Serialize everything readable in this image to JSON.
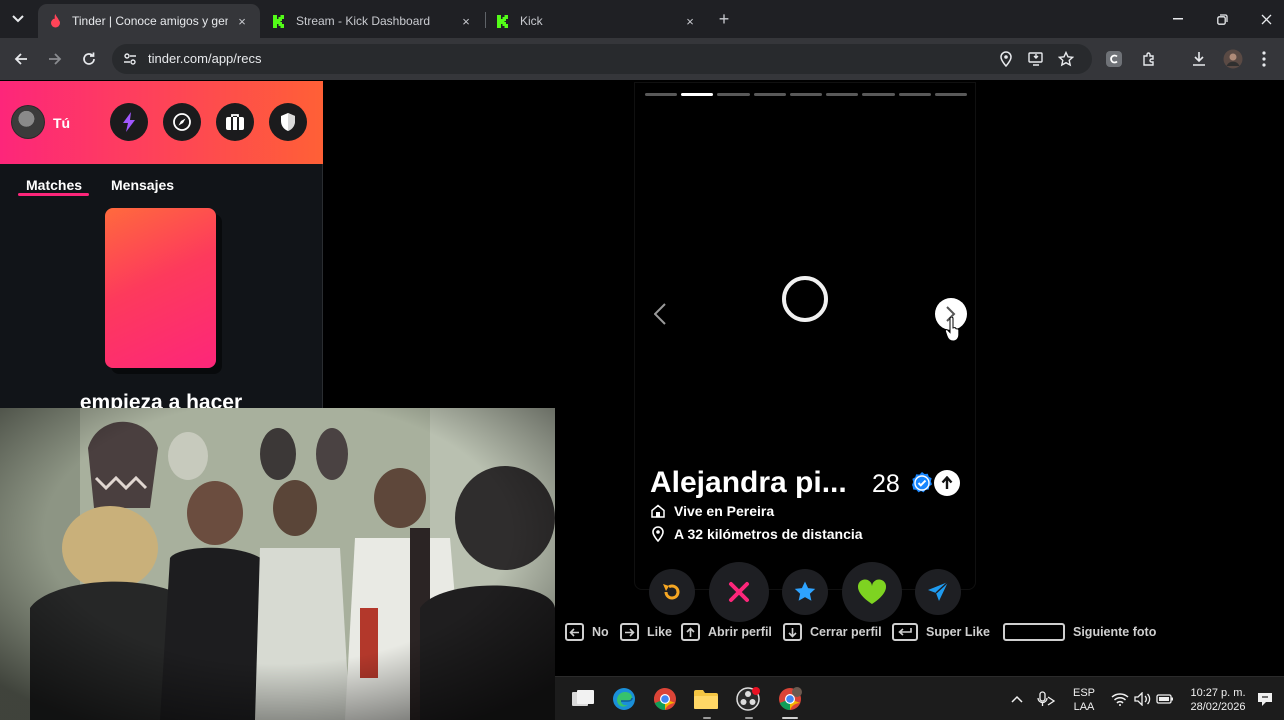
{
  "browser": {
    "tabs": [
      {
        "title": "Tinder | Conoce amigos y gente",
        "active": true
      },
      {
        "title": "Stream - Kick Dashboard",
        "active": false
      },
      {
        "title": "Kick",
        "active": false
      }
    ],
    "close_glyph": "×",
    "new_tab_glyph": "+",
    "url": "tinder.com/app/recs"
  },
  "sidebar": {
    "you_label": "Tú",
    "tabs": [
      "Matches",
      "Mensajes"
    ],
    "empty_text": "empieza a hacer",
    "header_buttons": [
      "bolt-icon",
      "compass-icon",
      "briefcase-icon",
      "shield-icon"
    ]
  },
  "profile": {
    "name": "Alejandra pi...",
    "age": "28",
    "lives_in": "Vive en Pereira",
    "distance": "A 32 kilómetros de distancia",
    "photo_count": 9,
    "active_photo": 1
  },
  "actions": [
    "rewind-icon",
    "nope-icon",
    "super-like-icon",
    "like-icon",
    "boost-icon"
  ],
  "shortcuts": [
    {
      "key": "left-arrow-key",
      "label": "No"
    },
    {
      "key": "right-arrow-key",
      "label": "Like"
    },
    {
      "key": "up-arrow-key",
      "label": "Abrir perfil"
    },
    {
      "key": "down-arrow-key",
      "label": "Cerrar perfil"
    },
    {
      "key": "enter-key",
      "label": "Super Like"
    },
    {
      "key": "space-key",
      "label": "Siguiente foto"
    }
  ],
  "taskbar": {
    "lang_top": "ESP",
    "lang_bottom": "LAA",
    "time": "10:27 p. m.",
    "date": "28/02/2026"
  },
  "colors": {
    "tinder_pink": "#fd267a",
    "tinder_orange": "#ff6036",
    "like_green": "#7ed321",
    "superlike_blue": "#2ea3ff",
    "rewind_orange": "#f5a623",
    "boost_blue": "#1f9bf0",
    "kick_green": "#53fc18"
  }
}
